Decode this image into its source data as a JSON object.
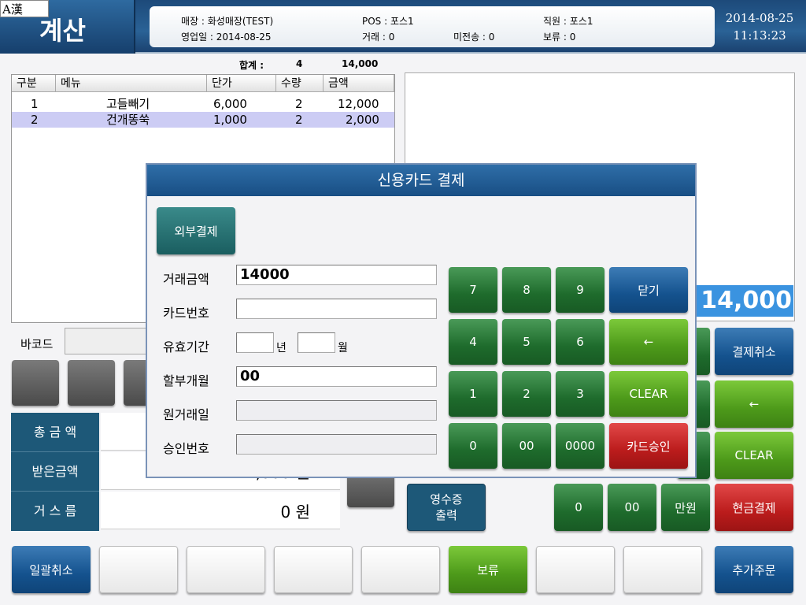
{
  "header": {
    "ime": "A漢",
    "title": "계산",
    "store": "매장 : 화성매장(TEST)",
    "business_date": "영업일 : 2014-08-25",
    "pos": "POS : 포스1",
    "transactions": "거래 : 0",
    "unsent": "미전송 : 0",
    "staff": "직원 : 포스1",
    "hold": "보류 : 0",
    "date": "2014-08-25",
    "time": "11:13:23"
  },
  "summary": {
    "label": "합계 :",
    "qty": "4",
    "amount": "14,000"
  },
  "grid": {
    "columns": [
      "구분",
      "메뉴",
      "단가",
      "수량",
      "금액"
    ],
    "rows": [
      [
        "1",
        "고들빼기",
        "6,000",
        "2",
        "12,000"
      ],
      [
        "2",
        "건개똥쑥",
        "1,000",
        "2",
        "2,000"
      ]
    ]
  },
  "display_amount": "14,000",
  "barcode_label": "바코드",
  "totals": {
    "total_label": "총 금 액",
    "received_label": "받은금액",
    "received_value": "14,000 원",
    "change_label": "거 스 름",
    "change_value": "0 원"
  },
  "keypad": {
    "receipt": "영수증\n출력",
    "cancel_payment": "결제취소",
    "backspace": "←",
    "clear": "CLEAR",
    "zero": "0",
    "double_zero": "00",
    "ten_thousand": "만원",
    "cash_payment": "현금결제"
  },
  "bottom": {
    "cancel_all": "일괄취소",
    "hold": "보류",
    "add_order": "추가주문"
  },
  "dialog": {
    "title": "신용카드 결제",
    "external": "외부결제",
    "amount_label": "거래금액",
    "amount_value": "14000",
    "card_label": "카드번호",
    "expiry_label": "유효기간",
    "year": "년",
    "month": "월",
    "installment_label": "할부개월",
    "installment_value": "00",
    "orig_date_label": "원거래일",
    "approval_label": "승인번호",
    "keys": [
      "7",
      "8",
      "9",
      "4",
      "5",
      "6",
      "1",
      "2",
      "3",
      "0",
      "00",
      "0000"
    ],
    "close": "닫기",
    "backspace": "←",
    "clear": "CLEAR",
    "approve": "카드승인"
  }
}
